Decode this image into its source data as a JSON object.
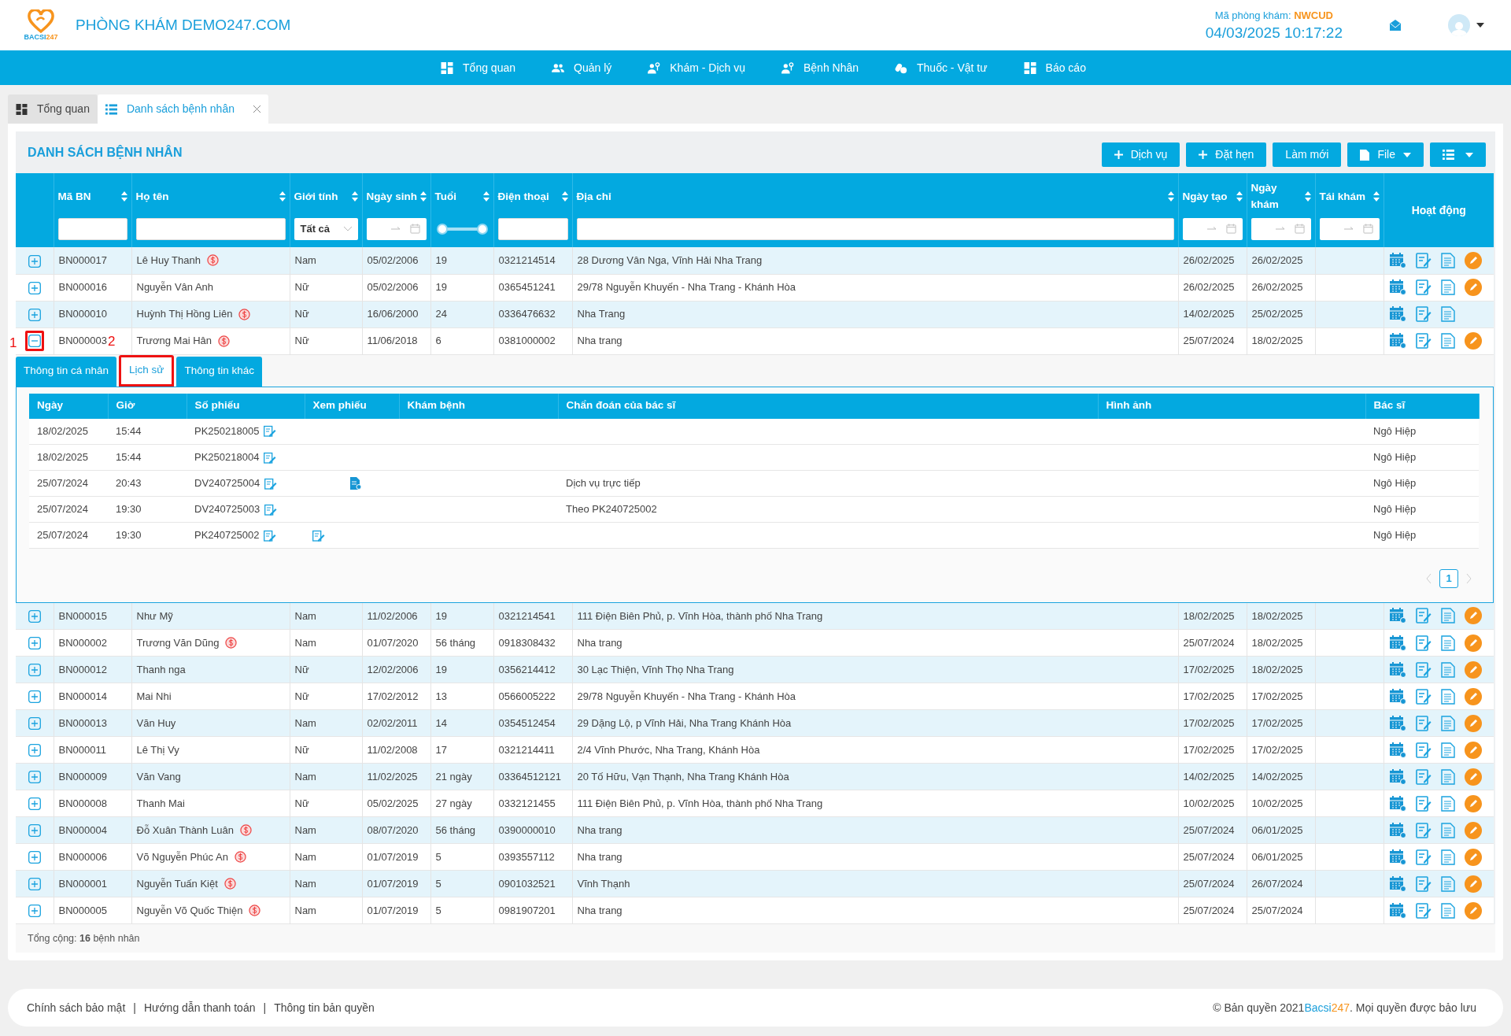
{
  "header": {
    "logo": {
      "part1": "BACSI",
      "part2": "247"
    },
    "clinic_name": "PHÒNG KHÁM DEMO247.COM",
    "clinic_code_label": "Mã phòng khám:",
    "clinic_code": "NWCUD",
    "datetime": "04/03/2025 10:17:22"
  },
  "nav": [
    {
      "label": "Tổng quan"
    },
    {
      "label": "Quản lý"
    },
    {
      "label": "Khám - Dịch vụ"
    },
    {
      "label": "Bệnh Nhân"
    },
    {
      "label": "Thuốc - Vật tư"
    },
    {
      "label": "Báo cáo"
    }
  ],
  "page_tabs": [
    {
      "label": "Tổng quan",
      "selected": false,
      "closable": false
    },
    {
      "label": "Danh sách bệnh nhân",
      "selected": true,
      "closable": true
    }
  ],
  "panel": {
    "title": "DANH SÁCH BỆNH NHÂN",
    "buttons": [
      {
        "label": "Dịch vụ",
        "kind": "add"
      },
      {
        "label": "Đặt hẹn",
        "kind": "add"
      },
      {
        "label": "Làm mới",
        "kind": "plain"
      },
      {
        "label": "File",
        "kind": "file"
      },
      {
        "kind": "columns"
      }
    ]
  },
  "table": {
    "columns": [
      {
        "label": "Mã BN",
        "kind": "text"
      },
      {
        "label": "Họ tên",
        "kind": "text"
      },
      {
        "label": "Giới tính",
        "kind": "select",
        "value": "Tất cả"
      },
      {
        "label": "Ngày sinh",
        "kind": "date"
      },
      {
        "label": "Tuổi",
        "kind": "range",
        "level": 1
      },
      {
        "label": "Điện thoại",
        "kind": "text"
      },
      {
        "label": "Địa chỉ",
        "kind": "text"
      },
      {
        "label": "Ngày tạo",
        "kind": "date"
      },
      {
        "label": "Ngày khám",
        "kind": "date"
      },
      {
        "label": "Tái khám",
        "kind": "date"
      },
      {
        "label": "Hoạt động",
        "kind": "actions"
      }
    ],
    "rows": [
      {
        "expanded": false,
        "id": "BN000017",
        "name": "Lê Huy Thanh",
        "fee": true,
        "gender": "Nam",
        "dob": "05/02/2006",
        "age": "19",
        "phone": "0321214514",
        "address": "28 Dương Vân Nga, Vĩnh Hải Nha Trang",
        "created": "26/02/2025",
        "visit": "26/02/2025",
        "edit": true
      },
      {
        "expanded": false,
        "id": "BN000016",
        "name": "Nguyễn Vân Anh",
        "fee": false,
        "gender": "Nữ",
        "dob": "05/02/2006",
        "age": "19",
        "phone": "0365451241",
        "address": "29/78 Nguyễn Khuyến - Nha Trang - Khánh Hòa",
        "created": "26/02/2025",
        "visit": "26/02/2025",
        "edit": true
      },
      {
        "expanded": false,
        "id": "BN000010",
        "name": "Huỳnh Thị Hồng Liên",
        "fee": true,
        "gender": "Nữ",
        "dob": "16/06/2000",
        "age": "24",
        "phone": "0336476632",
        "address": "Nha Trang",
        "created": "14/02/2025",
        "visit": "25/02/2025",
        "edit": false
      },
      {
        "expanded": true,
        "annotation": "1",
        "id": "BN000003",
        "annotation_2": "2",
        "name": "Trương Mai Hân",
        "fee": true,
        "gender": "Nữ",
        "dob": "11/06/2018",
        "age": "6",
        "phone": "0381000002",
        "address": "Nha trang",
        "created": "25/07/2024",
        "visit": "18/02/2025",
        "edit": true,
        "detail": {
          "tabs": [
            {
              "label": "Thông tin cá nhân",
              "selected": false
            },
            {
              "label": "Lịch sử",
              "selected": true,
              "highlighted": true
            },
            {
              "label": "Thông tin khác",
              "selected": false
            }
          ],
          "columns": [
            "Ngày",
            "Giờ",
            "Số phiếu",
            "Xem phiếu",
            "Khám bệnh",
            "Chẩn đoán của bác sĩ",
            "Hình ảnh",
            "Bác sĩ"
          ],
          "rows": [
            {
              "date": "18/02/2025",
              "time": "15:44",
              "ticket": "PK250218005",
              "kind": "none",
              "doctor": "Ngô Hiệp"
            },
            {
              "date": "18/02/2025",
              "time": "15:44",
              "ticket": "PK250218004",
              "kind": "none",
              "doctor": "Ngô Hiệp"
            },
            {
              "date": "25/07/2024",
              "time": "20:43",
              "ticket": "DV240725004",
              "kind": "report",
              "diagnosis": "Dịch vụ trực tiếp",
              "doctor": "Ngô Hiệp"
            },
            {
              "date": "25/07/2024",
              "time": "19:30",
              "ticket": "DV240725003",
              "kind": "none",
              "diagnosis": "Theo PK240725002",
              "doctor": "Ngô Hiệp"
            },
            {
              "date": "25/07/2024",
              "time": "19:30",
              "ticket": "PK240725002",
              "kind": "edit",
              "doctor": "Ngô Hiệp"
            }
          ],
          "page": "1"
        }
      },
      {
        "expanded": false,
        "id": "BN000015",
        "name": "Như Mỹ",
        "fee": false,
        "gender": "Nam",
        "dob": "11/02/2006",
        "age": "19",
        "phone": "0321214541",
        "address": "111 Điện Biên Phủ, p. Vĩnh Hòa, thành phố Nha Trang",
        "created": "18/02/2025",
        "visit": "18/02/2025",
        "edit": true
      },
      {
        "expanded": false,
        "id": "BN000002",
        "name": "Trương Văn Dũng",
        "fee": true,
        "gender": "Nam",
        "dob": "01/07/2020",
        "age": "56 tháng",
        "phone": "0918308432",
        "address": "Nha trang",
        "created": "25/07/2024",
        "visit": "18/02/2025",
        "edit": true
      },
      {
        "expanded": false,
        "id": "BN000012",
        "name": "Thanh nga",
        "fee": false,
        "gender": "Nữ",
        "dob": "12/02/2006",
        "age": "19",
        "phone": "0356214412",
        "address": "30 Lạc Thiện, Vĩnh Thọ Nha Trang",
        "created": "17/02/2025",
        "visit": "18/02/2025",
        "edit": true
      },
      {
        "expanded": false,
        "id": "BN000014",
        "name": "Mai Nhi",
        "fee": false,
        "gender": "Nữ",
        "dob": "17/02/2012",
        "age": "13",
        "phone": "0566005222",
        "address": "29/78 Nguyễn Khuyến - Nha Trang - Khánh Hòa",
        "created": "17/02/2025",
        "visit": "17/02/2025",
        "edit": true
      },
      {
        "expanded": false,
        "id": "BN000013",
        "name": "Văn Huy",
        "fee": false,
        "gender": "Nam",
        "dob": "02/02/2011",
        "age": "14",
        "phone": "0354512454",
        "address": "29 Dặng Lộ, p Vĩnh Hải, Nha Trang Khánh Hòa",
        "created": "17/02/2025",
        "visit": "17/02/2025",
        "edit": true
      },
      {
        "expanded": false,
        "id": "BN000011",
        "name": "Lê Thị Vy",
        "fee": false,
        "gender": "Nữ",
        "dob": "11/02/2008",
        "age": "17",
        "phone": "0321214411",
        "address": "2/4 Vĩnh Phước, Nha Trang, Khánh Hòa",
        "created": "17/02/2025",
        "visit": "17/02/2025",
        "edit": true
      },
      {
        "expanded": false,
        "id": "BN000009",
        "name": "Văn Vang",
        "fee": false,
        "gender": "Nam",
        "dob": "11/02/2025",
        "age": "21 ngày",
        "phone": "03364512121",
        "address": "20 Tố Hữu, Vạn Thạnh, Nha Trang Khánh Hòa",
        "created": "14/02/2025",
        "visit": "14/02/2025",
        "edit": true
      },
      {
        "expanded": false,
        "id": "BN000008",
        "name": "Thanh Mai",
        "fee": false,
        "gender": "Nữ",
        "dob": "05/02/2025",
        "age": "27 ngày",
        "phone": "0332121455",
        "address": "111 Điện Biên Phủ, p. Vĩnh Hòa, thành phố Nha Trang",
        "created": "10/02/2025",
        "visit": "10/02/2025",
        "edit": true
      },
      {
        "expanded": false,
        "id": "BN000004",
        "name": "Đỗ Xuân Thành Luân",
        "fee": true,
        "gender": "Nam",
        "dob": "08/07/2020",
        "age": "56 tháng",
        "phone": "0390000010",
        "address": "Nha trang",
        "created": "25/07/2024",
        "visit": "06/01/2025",
        "edit": true
      },
      {
        "expanded": false,
        "id": "BN000006",
        "name": "Võ Nguyễn Phúc An",
        "fee": true,
        "gender": "Nam",
        "dob": "01/07/2019",
        "age": "5",
        "phone": "0393557112",
        "address": "Nha trang",
        "created": "25/07/2024",
        "visit": "06/01/2025",
        "edit": true
      },
      {
        "expanded": false,
        "id": "BN000001",
        "name": "Nguyễn Tuấn Kiệt",
        "fee": true,
        "gender": "Nam",
        "dob": "01/07/2019",
        "age": "5",
        "phone": "0901032521",
        "address": "Vĩnh Thạnh",
        "created": "25/07/2024",
        "visit": "26/07/2024",
        "edit": true
      },
      {
        "expanded": false,
        "id": "BN000005",
        "name": "Nguyễn Võ Quốc Thiện",
        "fee": true,
        "gender": "Nam",
        "dob": "01/07/2019",
        "age": "5",
        "phone": "0981907201",
        "address": "Nha trang",
        "created": "25/07/2024",
        "visit": "25/07/2024",
        "edit": true
      }
    ],
    "total": "Tổng cộng: **16** bệnh nhân"
  },
  "footer": {
    "links": [
      "Chính sách bảo mật",
      "Hướng dẫn thanh toán",
      "Thông tin bản quyền"
    ],
    "separator": "|",
    "copyright": {
      "before": "© Bản quyền 2021",
      "brand1": "Bacsi",
      "brand2": "247",
      "after": ". Mọi quyền được bảo lưu"
    }
  }
}
